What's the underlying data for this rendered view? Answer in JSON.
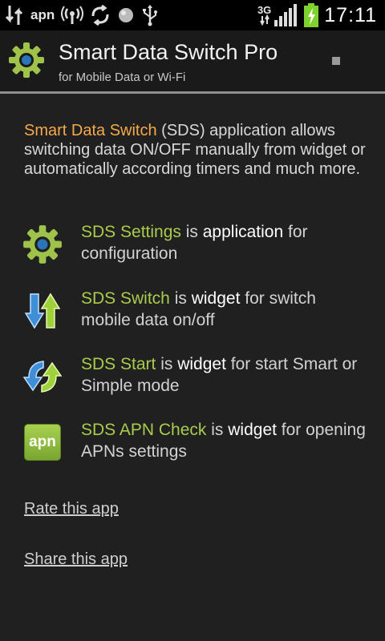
{
  "status_bar": {
    "apn_label": "apn",
    "network_type": "3G",
    "time": "17:11",
    "icons": [
      "data-arrows-icon",
      "apn-text",
      "wifi-hotspot-icon",
      "sync-arrows-icon",
      "globe-icon",
      "usb-icon",
      "signal-icon",
      "battery-charging-icon"
    ],
    "battery_color": "#7fd12e"
  },
  "action_bar": {
    "title": "Smart Data Switch Pro",
    "subtitle": "for Mobile Data or Wi-Fi",
    "icon": "gear-icon"
  },
  "intro": {
    "app_name": "Smart Data Switch",
    "rest": " (SDS) application allows switching data ON/OFF manually from widget or automatically according timers and much more."
  },
  "features": [
    {
      "icon": "gear-icon",
      "name": "SDS Settings",
      "is": " is ",
      "kind": "application",
      "rest": " for configuration"
    },
    {
      "icon": "up-down-arrows-icon",
      "name": "SDS Switch",
      "is": " is ",
      "kind": "widget",
      "rest": " for switch mobile data on/off"
    },
    {
      "icon": "circular-arrows-icon",
      "name": "SDS Start",
      "is": " is ",
      "kind": "widget",
      "rest": " for start Smart or Simple mode"
    },
    {
      "icon": "apn-badge-icon",
      "badge_text": "apn",
      "name": "SDS APN Check",
      "is": " is ",
      "kind": "widget",
      "rest": " for opening APNs settings"
    }
  ],
  "links": {
    "rate": "Rate this app",
    "share": "Share this app"
  },
  "colors": {
    "accent_orange": "#f5a94a",
    "accent_green": "#a9cc4c",
    "background": "#202020"
  }
}
